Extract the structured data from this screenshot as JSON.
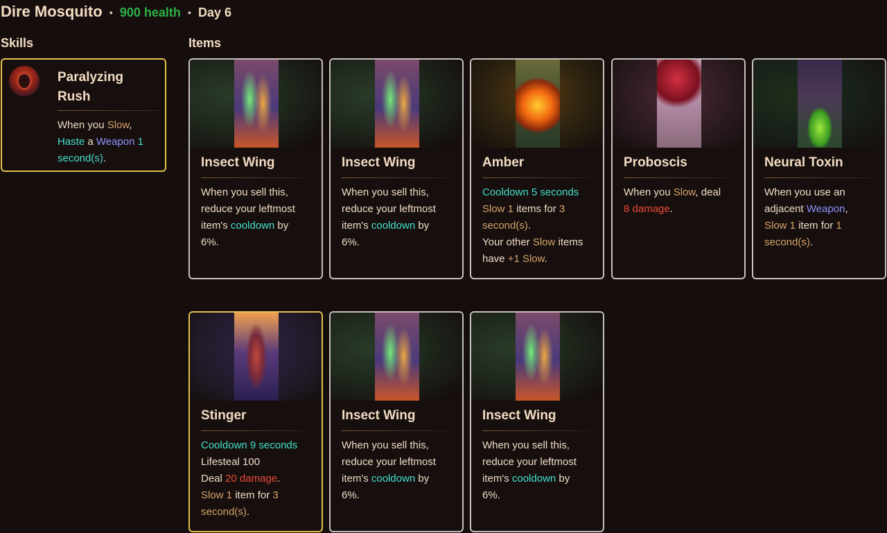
{
  "header": {
    "name": "Dire Mosquito",
    "sep1": "•",
    "health": "900 health",
    "sep2": "•",
    "day": "Day 6"
  },
  "sections": {
    "skills": "Skills",
    "items": "Items"
  },
  "skill": {
    "title_line1": "Paralyzing",
    "title_line2": "Rush",
    "desc": {
      "p1": "When you ",
      "slow": "Slow",
      "p2": ", ",
      "haste": "Haste",
      "p3": " a ",
      "weapon": "Weapon",
      "sp": " ",
      "num": "1",
      "p4": " ",
      "secs": "second(s)",
      "p5": "."
    }
  },
  "items": [
    {
      "title": "Insect Wing",
      "lines": [
        "When you sell this,",
        "reduce your leftmost"
      ],
      "l3a": "item's ",
      "l3b": "cooldown",
      "l3c": " by",
      "l4": "6%."
    },
    {
      "title": "Insect Wing",
      "lines": [
        "When you sell this,",
        "reduce your leftmost"
      ],
      "l3a": "item's ",
      "l3b": "cooldown",
      "l3c": " by",
      "l4": "6%."
    },
    {
      "title": "Amber",
      "cool": "Cooldown 5 seconds",
      "l2a": "Slow 1",
      "l2b": " items for ",
      "l2c": "3",
      "l3": "second(s)",
      "l3b": ".",
      "l4a": "Your other ",
      "l4b": "Slow",
      "l4c": " items",
      "l5a": "have ",
      "l5b": "+1 Slow",
      "l5c": "."
    },
    {
      "title": "Proboscis",
      "l1a": "When you ",
      "l1b": "Slow",
      "l1c": ", deal",
      "l2a": "8 damage",
      "l2b": "."
    },
    {
      "title": "Neural Toxin",
      "l1": "When you use an",
      "l2a": "adjacent ",
      "l2b": "Weapon",
      "l2c": ",",
      "l3a": "Slow 1",
      "l3b": " item for ",
      "l3c": "1",
      "l4a": "second(s)",
      "l4b": "."
    },
    {
      "title": "Stinger",
      "cool": "Cooldown 9 seconds",
      "life": "Lifesteal 100",
      "l3a": "Deal ",
      "l3b": "20 damage",
      "l3c": ".",
      "l4a": "Slow 1",
      "l4b": " item for ",
      "l4c": "3",
      "l5a": "second(s)",
      "l5b": "."
    },
    {
      "title": "Insect Wing",
      "lines": [
        "When you sell this,",
        "reduce your leftmost"
      ],
      "l3a": "item's ",
      "l3b": "cooldown",
      "l3c": " by",
      "l4": "6%."
    },
    {
      "title": "Insect Wing",
      "lines": [
        "When you sell this,",
        "reduce your leftmost"
      ],
      "l3a": "item's ",
      "l3b": "cooldown",
      "l3c": " by",
      "l4": "6%."
    }
  ]
}
